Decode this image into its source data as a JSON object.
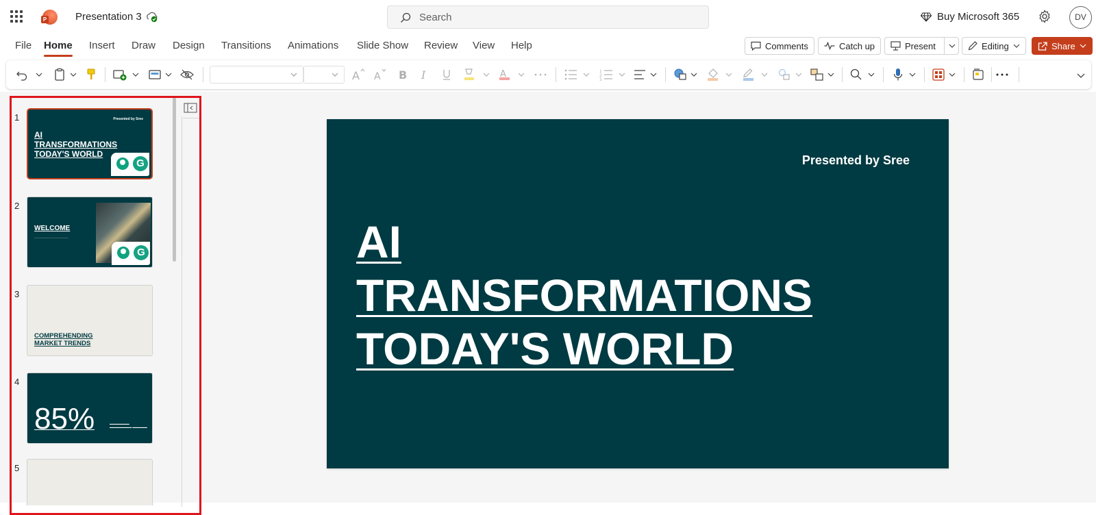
{
  "app": {
    "doc_title": "Presentation 3",
    "search_placeholder": "Search",
    "buy_label": "Buy Microsoft 365",
    "avatar_initials": "DV",
    "accent_color": "#c43e1c"
  },
  "menu": {
    "tabs": [
      "File",
      "Home",
      "Insert",
      "Draw",
      "Design",
      "Transitions",
      "Animations",
      "Slide Show",
      "Review",
      "View",
      "Help"
    ],
    "active_tab": "Home",
    "comments_label": "Comments",
    "catchup_label": "Catch up",
    "present_label": "Present",
    "editing_label": "Editing",
    "share_label": "Share"
  },
  "slides": [
    {
      "number": "1",
      "presenter": "Presented by Sree",
      "title_lines": [
        "AI",
        "TRANSFORMATIONS",
        "TODAY'S WORLD"
      ]
    },
    {
      "number": "2",
      "title": "WELCOME",
      "bullets": [
        "",
        "",
        "",
        ""
      ]
    },
    {
      "number": "3",
      "title_lines": [
        "COMPREHENDING",
        "MARKET TRENDS"
      ]
    },
    {
      "number": "4",
      "big_number": "85%"
    },
    {
      "number": "5"
    }
  ],
  "main_slide": {
    "presenter": "Presented by  Sree",
    "title_lines": [
      "AI",
      "TRANSFORMATIONS",
      "TODAY'S WORLD"
    ],
    "background": "#003a42"
  }
}
